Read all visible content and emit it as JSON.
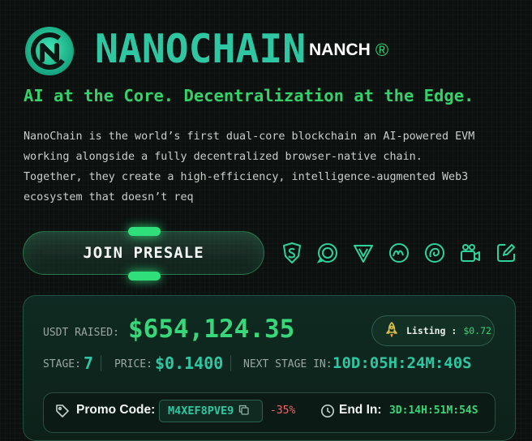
{
  "brand": {
    "name": "NANOCHAIN",
    "ticker": "NANCH",
    "ticker_mark": "®",
    "logo_icon": "nanochain-logo-icon"
  },
  "tagline": "AI at the Core. Decentralization at the Edge.",
  "description": {
    "lines": [
      "NanoChain is the world’s first dual-core blockchain an AI-powered EVM",
      "working alongside a fully decentralized browser-native chain.",
      "Together, they create a high-efficiency, intelligence-augmented Web3",
      "ecosystem that doesn’t req"
    ]
  },
  "cta": {
    "join_label": "JOIN PRESALE"
  },
  "socials": [
    {
      "icon": "shield-s-icon"
    },
    {
      "icon": "coin-check-icon"
    },
    {
      "icon": "v-badge-icon"
    },
    {
      "icon": "swirl-icon"
    },
    {
      "icon": "spiral-icon"
    },
    {
      "icon": "video-camera-icon"
    },
    {
      "icon": "external-edit-icon"
    }
  ],
  "presale": {
    "raised_label": "USDT RAISED:",
    "raised_value": "$654,124.35",
    "listing_label": "Listing :",
    "listing_value": "$0.72",
    "listing_icon": "rocket-icon",
    "stage_label": "STAGE:",
    "stage_value": "7",
    "price_label": "PRICE:",
    "price_value": "$0.1400",
    "next_label": "NEXT STAGE IN:",
    "next_value": "10D:05H:24M:40S"
  },
  "promo": {
    "label": "Promo Code:",
    "code": "M4XEF8PVE9",
    "discount": "-35%",
    "end_label": "End In:",
    "end_value": "3D:14H:51M:54S"
  },
  "colors": {
    "accent_teal": "#2ec7a1",
    "accent_green": "#36d777",
    "discount_red": "#f06a6a",
    "background": "#0c1110"
  }
}
